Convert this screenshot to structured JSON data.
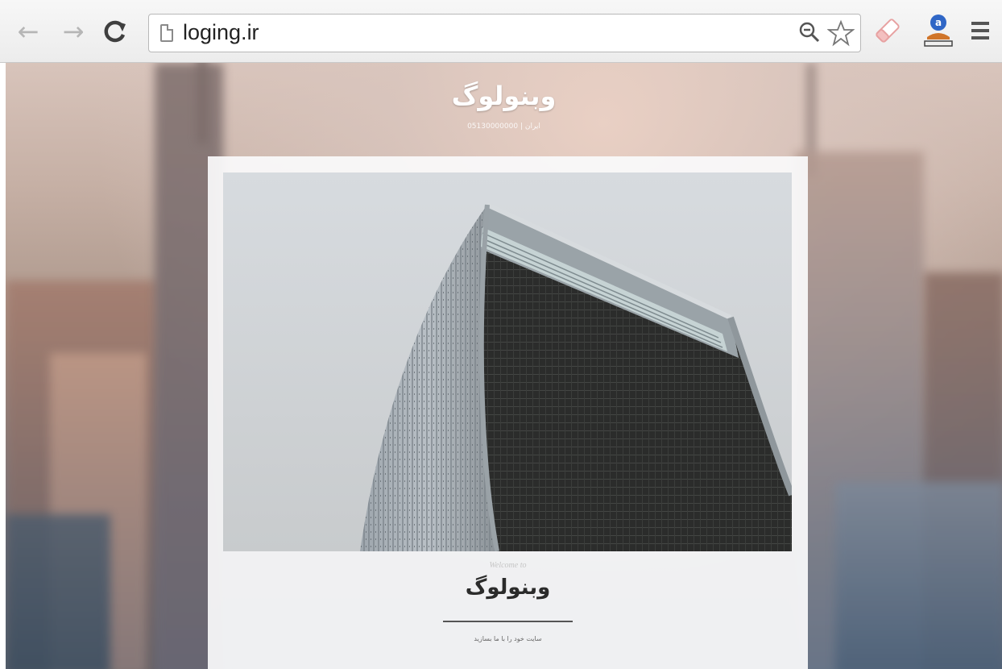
{
  "browser": {
    "url": "loging.ir",
    "nav": {
      "back_glyph": "←",
      "forward_glyph": "→",
      "reload_glyph": "C"
    },
    "icons": [
      "back-arrow-icon",
      "forward-arrow-icon",
      "reload-icon",
      "page-icon",
      "zoom-out-icon",
      "star-icon",
      "eraser-extension-icon",
      "user-extension-icon",
      "menu-icon"
    ]
  },
  "page": {
    "site_title": "وبنولوگ",
    "site_subtitle": "ایران | 05130000000",
    "card": {
      "welcome": "Welcome to",
      "title": "وبنولوگ",
      "tagline": "سایت خود را با ما بسازید"
    }
  },
  "colors": {
    "title_white": "#ffffff",
    "card_bg": "#fafafb",
    "divider": "#555555"
  }
}
